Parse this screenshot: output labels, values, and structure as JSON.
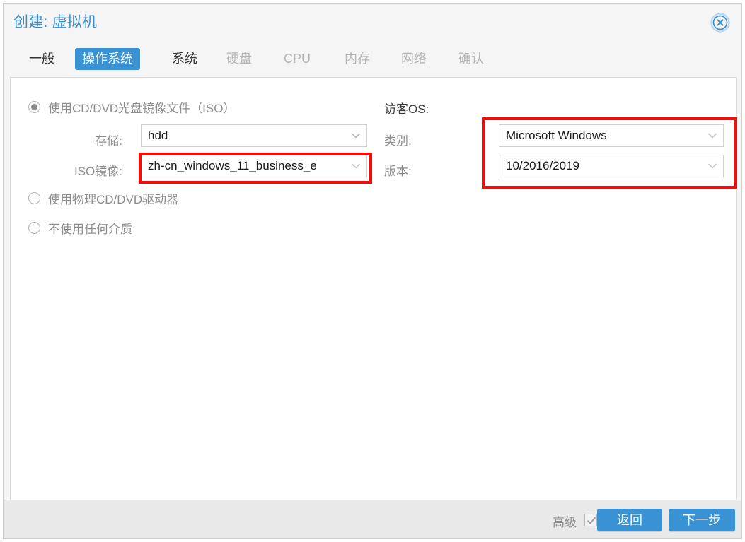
{
  "window": {
    "title": "创建: 虚拟机",
    "close_icon": "close-circle-icon",
    "accent_color": "#3892d4",
    "title_color": "#3c8dcd",
    "highlight_color": "#fa0a06"
  },
  "tabs": [
    {
      "label": "一般",
      "state": "enabled"
    },
    {
      "label": "操作系统",
      "state": "active"
    },
    {
      "label": "系统",
      "state": "enabled"
    },
    {
      "label": "硬盘",
      "state": "disabled"
    },
    {
      "label": "CPU",
      "state": "disabled"
    },
    {
      "label": "内存",
      "state": "disabled"
    },
    {
      "label": "网络",
      "state": "disabled"
    },
    {
      "label": "确认",
      "state": "disabled"
    }
  ],
  "media": {
    "options": [
      {
        "label": "使用CD/DVD光盘镜像文件（ISO）",
        "checked": true
      },
      {
        "label": "使用物理CD/DVD驱动器",
        "checked": false
      },
      {
        "label": "不使用任何介质",
        "checked": false
      }
    ],
    "storage": {
      "label": "存储:",
      "value": "hdd",
      "caret_icon": "chevron-down-icon"
    },
    "iso": {
      "label": "ISO镜像:",
      "value": "zh-cn_windows_11_business_e",
      "caret_icon": "chevron-down-icon",
      "highlighted": true
    }
  },
  "guest_os": {
    "heading": "访客OS:",
    "type": {
      "label": "类别:",
      "value": "Microsoft Windows",
      "caret_icon": "chevron-down-icon"
    },
    "version": {
      "label": "版本:",
      "value": "10/2016/2019",
      "caret_icon": "chevron-down-icon"
    },
    "highlighted": true
  },
  "footer": {
    "advanced_label": "高级",
    "advanced_checked": true,
    "check_icon": "checkmark-icon",
    "back_label": "返回",
    "next_label": "下一步"
  }
}
